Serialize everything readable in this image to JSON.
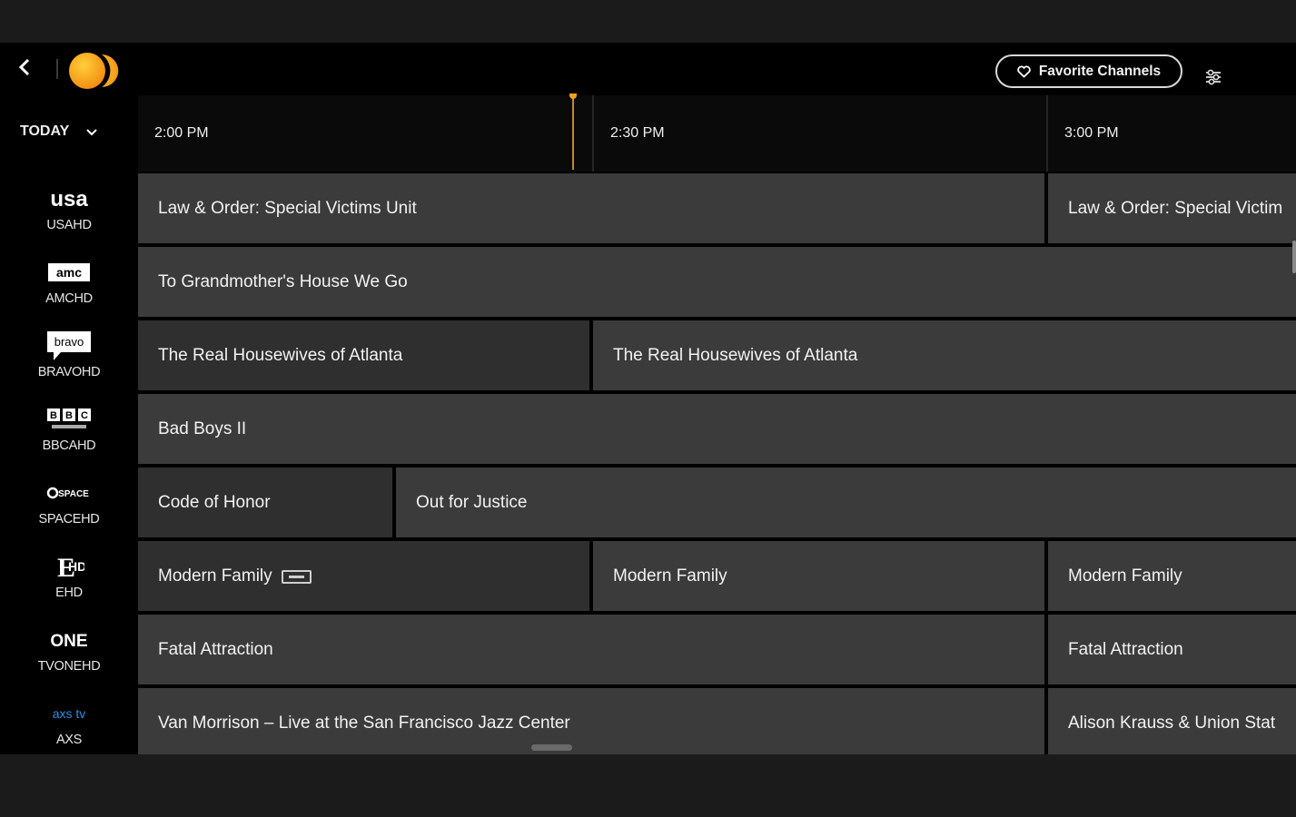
{
  "header": {
    "back_icon": "chevron-left-icon",
    "logo": "sling-logo",
    "favorite_label": "Favorite Channels",
    "favorite_icon": "heart-outline-icon",
    "settings_icon": "sliders-icon"
  },
  "day_selector": {
    "label": "TODAY",
    "icon": "chevron-down-icon"
  },
  "timeline": [
    "2:00 PM",
    "2:30 PM",
    "3:00 PM"
  ],
  "channels": [
    {
      "name": "USAHD",
      "logo": "usa-logo"
    },
    {
      "name": "AMCHD",
      "logo": "amc-logo"
    },
    {
      "name": "BRAVOHD",
      "logo": "bravo-logo"
    },
    {
      "name": "BBCAHD",
      "logo": "bbc-america-logo"
    },
    {
      "name": "SPACEHD",
      "logo": "space-logo"
    },
    {
      "name": "EHD",
      "logo": "e-logo"
    },
    {
      "name": "TVONEHD",
      "logo": "tvone-logo"
    },
    {
      "name": "AXS",
      "logo": "axs-logo"
    }
  ],
  "programs": [
    [
      "Law & Order: Special Victims Unit",
      "Law & Order: Special Victim"
    ],
    [
      "To Grandmother's House We Go"
    ],
    [
      "The Real Housewives of Atlanta",
      "The Real Housewives of Atlanta"
    ],
    [
      "Bad Boys II"
    ],
    [
      "Code of Honor",
      "Out for Justice"
    ],
    [
      "Modern Family",
      "Modern Family",
      "Modern Family"
    ],
    [
      "Fatal Attraction",
      "Fatal Attraction"
    ],
    [
      "Van Morrison – Live at the San Francisco Jazz Center",
      "Alison Krauss & Union Stat"
    ]
  ],
  "colors": {
    "accent": "#f0a11e",
    "cell": "#3b3b3b",
    "background": "#000000"
  }
}
